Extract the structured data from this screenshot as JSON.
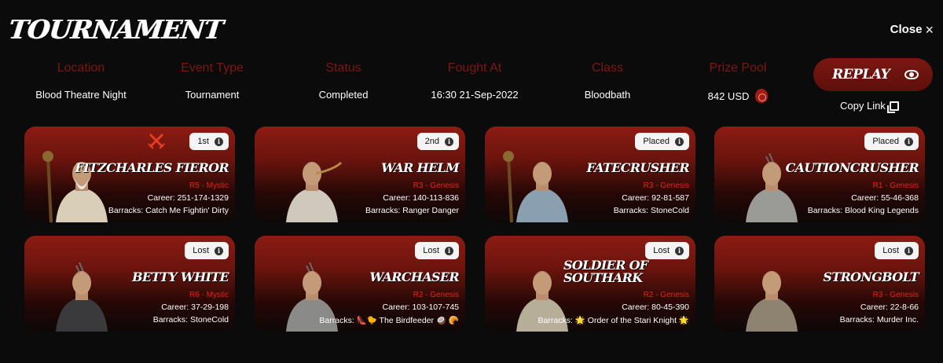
{
  "header": {
    "title": "TOURNAMENT",
    "close_label": "Close",
    "close_icon": "×"
  },
  "info": {
    "labels": [
      "Location",
      "Event Type",
      "Status",
      "Fought At",
      "Class",
      "Prize Pool"
    ],
    "values": [
      "Blood Theatre Night",
      "Tournament",
      "Completed",
      "16:30 21-Sep-2022",
      "Bloodbath",
      "842 USD"
    ]
  },
  "actions": {
    "replay_label": "REPLAY",
    "copy_link_label": "Copy Link"
  },
  "colors": {
    "accent_red": "#7e1713",
    "rank_red": "#e0261c",
    "card_top": "#8c1c12",
    "background": "#0b0b0b"
  },
  "fighters": [
    {
      "name": "FITZCHARLES FIEROR",
      "rank": "R5 - Mystic",
      "career": "Career: 251-174-1329",
      "barracks": "Barracks: Catch Me Fightin' Dirty",
      "result": "1st",
      "icon": "crossed-swords-icon"
    },
    {
      "name": "WAR HELM",
      "rank": "R3 - Genesis",
      "career": "Career: 140-113-836",
      "barracks": "Barracks: Ranger Danger",
      "result": "2nd"
    },
    {
      "name": "FATECRUSHER",
      "rank": "R3 - Genesis",
      "career": "Career: 92-81-587",
      "barracks": "Barracks: StoneCold",
      "result": "Placed"
    },
    {
      "name": "CAUTIONCRUSHER",
      "rank": "R1 - Genesis",
      "career": "Career: 55-46-368",
      "barracks": "Barracks: Blood King Legends",
      "result": "Placed"
    },
    {
      "name": "BETTY WHITE",
      "rank": "R6 - Mystic",
      "career": "Career: 37-29-198",
      "barracks": "Barracks: StoneCold",
      "result": "Lost"
    },
    {
      "name": "WARCHASER",
      "rank": "R2 - Genesis",
      "career": "Career: 103-107-745",
      "barracks": "Barracks: 👠🐤 The Birdfeeder 🥥 🥐",
      "result": "Lost"
    },
    {
      "name": "SOLDIER OF SOUTHARK",
      "rank": "R2 - Genesis",
      "career": "Career: 80-45-390",
      "barracks": "Barracks: 🌟 Order of the Stari Knight 🌟",
      "result": "Lost"
    },
    {
      "name": "STRONGBOLT",
      "rank": "R3 - Genesis",
      "career": "Career: 22-8-66",
      "barracks": "Barracks: Murder Inc.",
      "result": "Lost"
    }
  ]
}
